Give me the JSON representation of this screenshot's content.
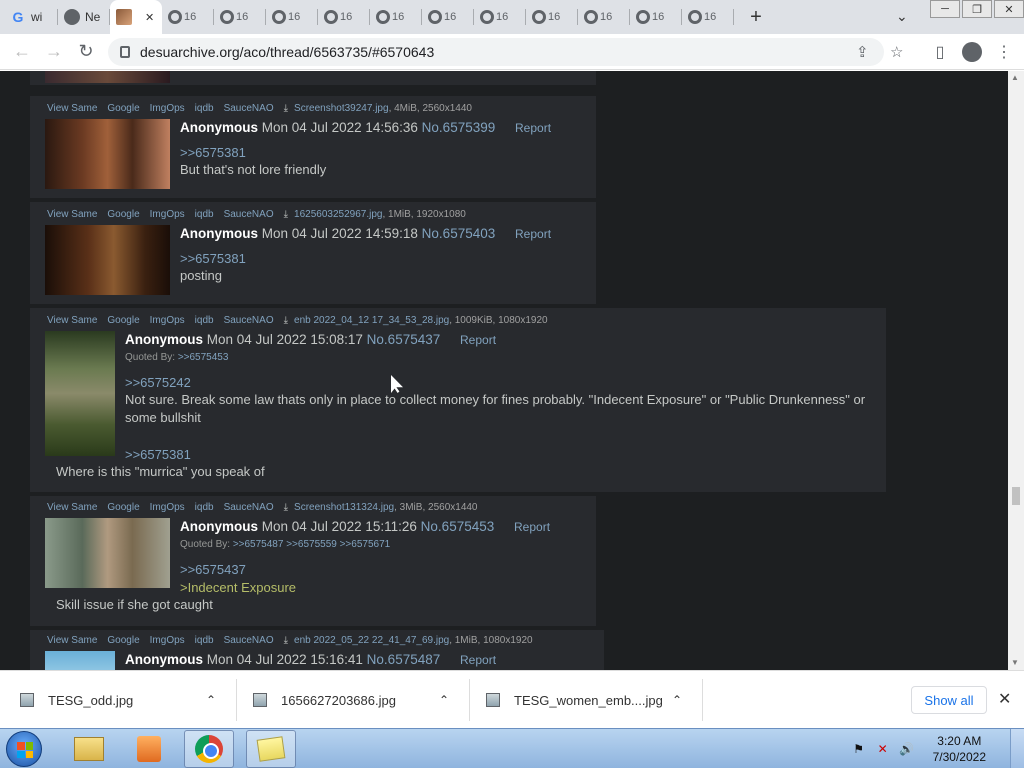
{
  "browser": {
    "tabs": [
      {
        "label": "wi",
        "icon": "google-icon"
      },
      {
        "label": "Ne",
        "icon": "github-icon"
      },
      {
        "label": "",
        "icon": "site-icon",
        "active": true,
        "close": "✕"
      },
      {
        "label": "16",
        "icon": "globe-icon"
      },
      {
        "label": "16",
        "icon": "globe-icon"
      },
      {
        "label": "16",
        "icon": "globe-icon"
      },
      {
        "label": "16",
        "icon": "globe-icon"
      },
      {
        "label": "16",
        "icon": "globe-icon"
      },
      {
        "label": "16",
        "icon": "globe-icon"
      },
      {
        "label": "16",
        "icon": "globe-icon"
      },
      {
        "label": "16",
        "icon": "globe-icon"
      },
      {
        "label": "16",
        "icon": "globe-icon"
      },
      {
        "label": "16",
        "icon": "globe-icon"
      },
      {
        "label": "16",
        "icon": "globe-icon"
      }
    ],
    "new_tab": "+",
    "url": "desuarchive.org/aco/thread/6563735/#6570643"
  },
  "posts": [
    {
      "links": [
        "View Same",
        "Google",
        "ImgOps",
        "iqdb",
        "SauceNAO"
      ],
      "filename": "Screenshot39247.jpg",
      "fileinfo": ", 4MiB, 2560x1440",
      "name": "Anonymous",
      "date": "Mon 04 Jul 2022 14:56:36",
      "no": "No.6575399",
      "report": "Report",
      "quote": ">>6575381",
      "text": "But that's not lore friendly"
    },
    {
      "links": [
        "View Same",
        "Google",
        "ImgOps",
        "iqdb",
        "SauceNAO"
      ],
      "filename": "1625603252967.jpg",
      "fileinfo": ", 1MiB, 1920x1080",
      "name": "Anonymous",
      "date": "Mon 04 Jul 2022 14:59:18",
      "no": "No.6575403",
      "report": "Report",
      "quote": ">>6575381",
      "text": "posting"
    },
    {
      "links": [
        "View Same",
        "Google",
        "ImgOps",
        "iqdb",
        "SauceNAO"
      ],
      "filename": "enb 2022_04_12 17_34_53_28.jpg",
      "fileinfo": ", 1009KiB, 1080x1920",
      "name": "Anonymous",
      "date": "Mon 04 Jul 2022 15:08:17",
      "no": "No.6575437",
      "report": "Report",
      "quoted_by_label": "Quoted By:",
      "quoted_by": ">>6575453",
      "quote": ">>6575242",
      "text": "Not sure. Break some law thats only in place to collect money for fines probably. \"Indecent Exposure\" or \"Public Drunkenness\" or",
      "text2": "some bullshit",
      "quote2": ">>6575381",
      "text3": "Where is this \"murrica\" you speak of"
    },
    {
      "links": [
        "View Same",
        "Google",
        "ImgOps",
        "iqdb",
        "SauceNAO"
      ],
      "filename": "Screenshot131324.jpg",
      "fileinfo": ", 3MiB, 2560x1440",
      "name": "Anonymous",
      "date": "Mon 04 Jul 2022 15:11:26",
      "no": "No.6575453",
      "report": "Report",
      "quoted_by_label": "Quoted By:",
      "quoted_by": ">>6575487 >>6575559 >>6575671",
      "quote": ">>6575437",
      "greentext": ">Indecent Exposure",
      "text": "Skill issue if she got caught"
    },
    {
      "links": [
        "View Same",
        "Google",
        "ImgOps",
        "iqdb",
        "SauceNAO"
      ],
      "filename": "enb 2022_05_22 22_41_47_69.jpg",
      "fileinfo": ", 1MiB, 1080x1920",
      "name": "Anonymous",
      "date": "Mon 04 Jul 2022 15:16:41",
      "no": "No.6575487",
      "report": "Report"
    }
  ],
  "downloads": {
    "items": [
      "TESG_odd.jpg",
      "1656627203686.jpg",
      "TESG_women_emb....jpg"
    ],
    "show_all": "Show all",
    "close": "✕"
  },
  "taskbar": {
    "time": "3:20 AM",
    "date": "7/30/2022"
  }
}
